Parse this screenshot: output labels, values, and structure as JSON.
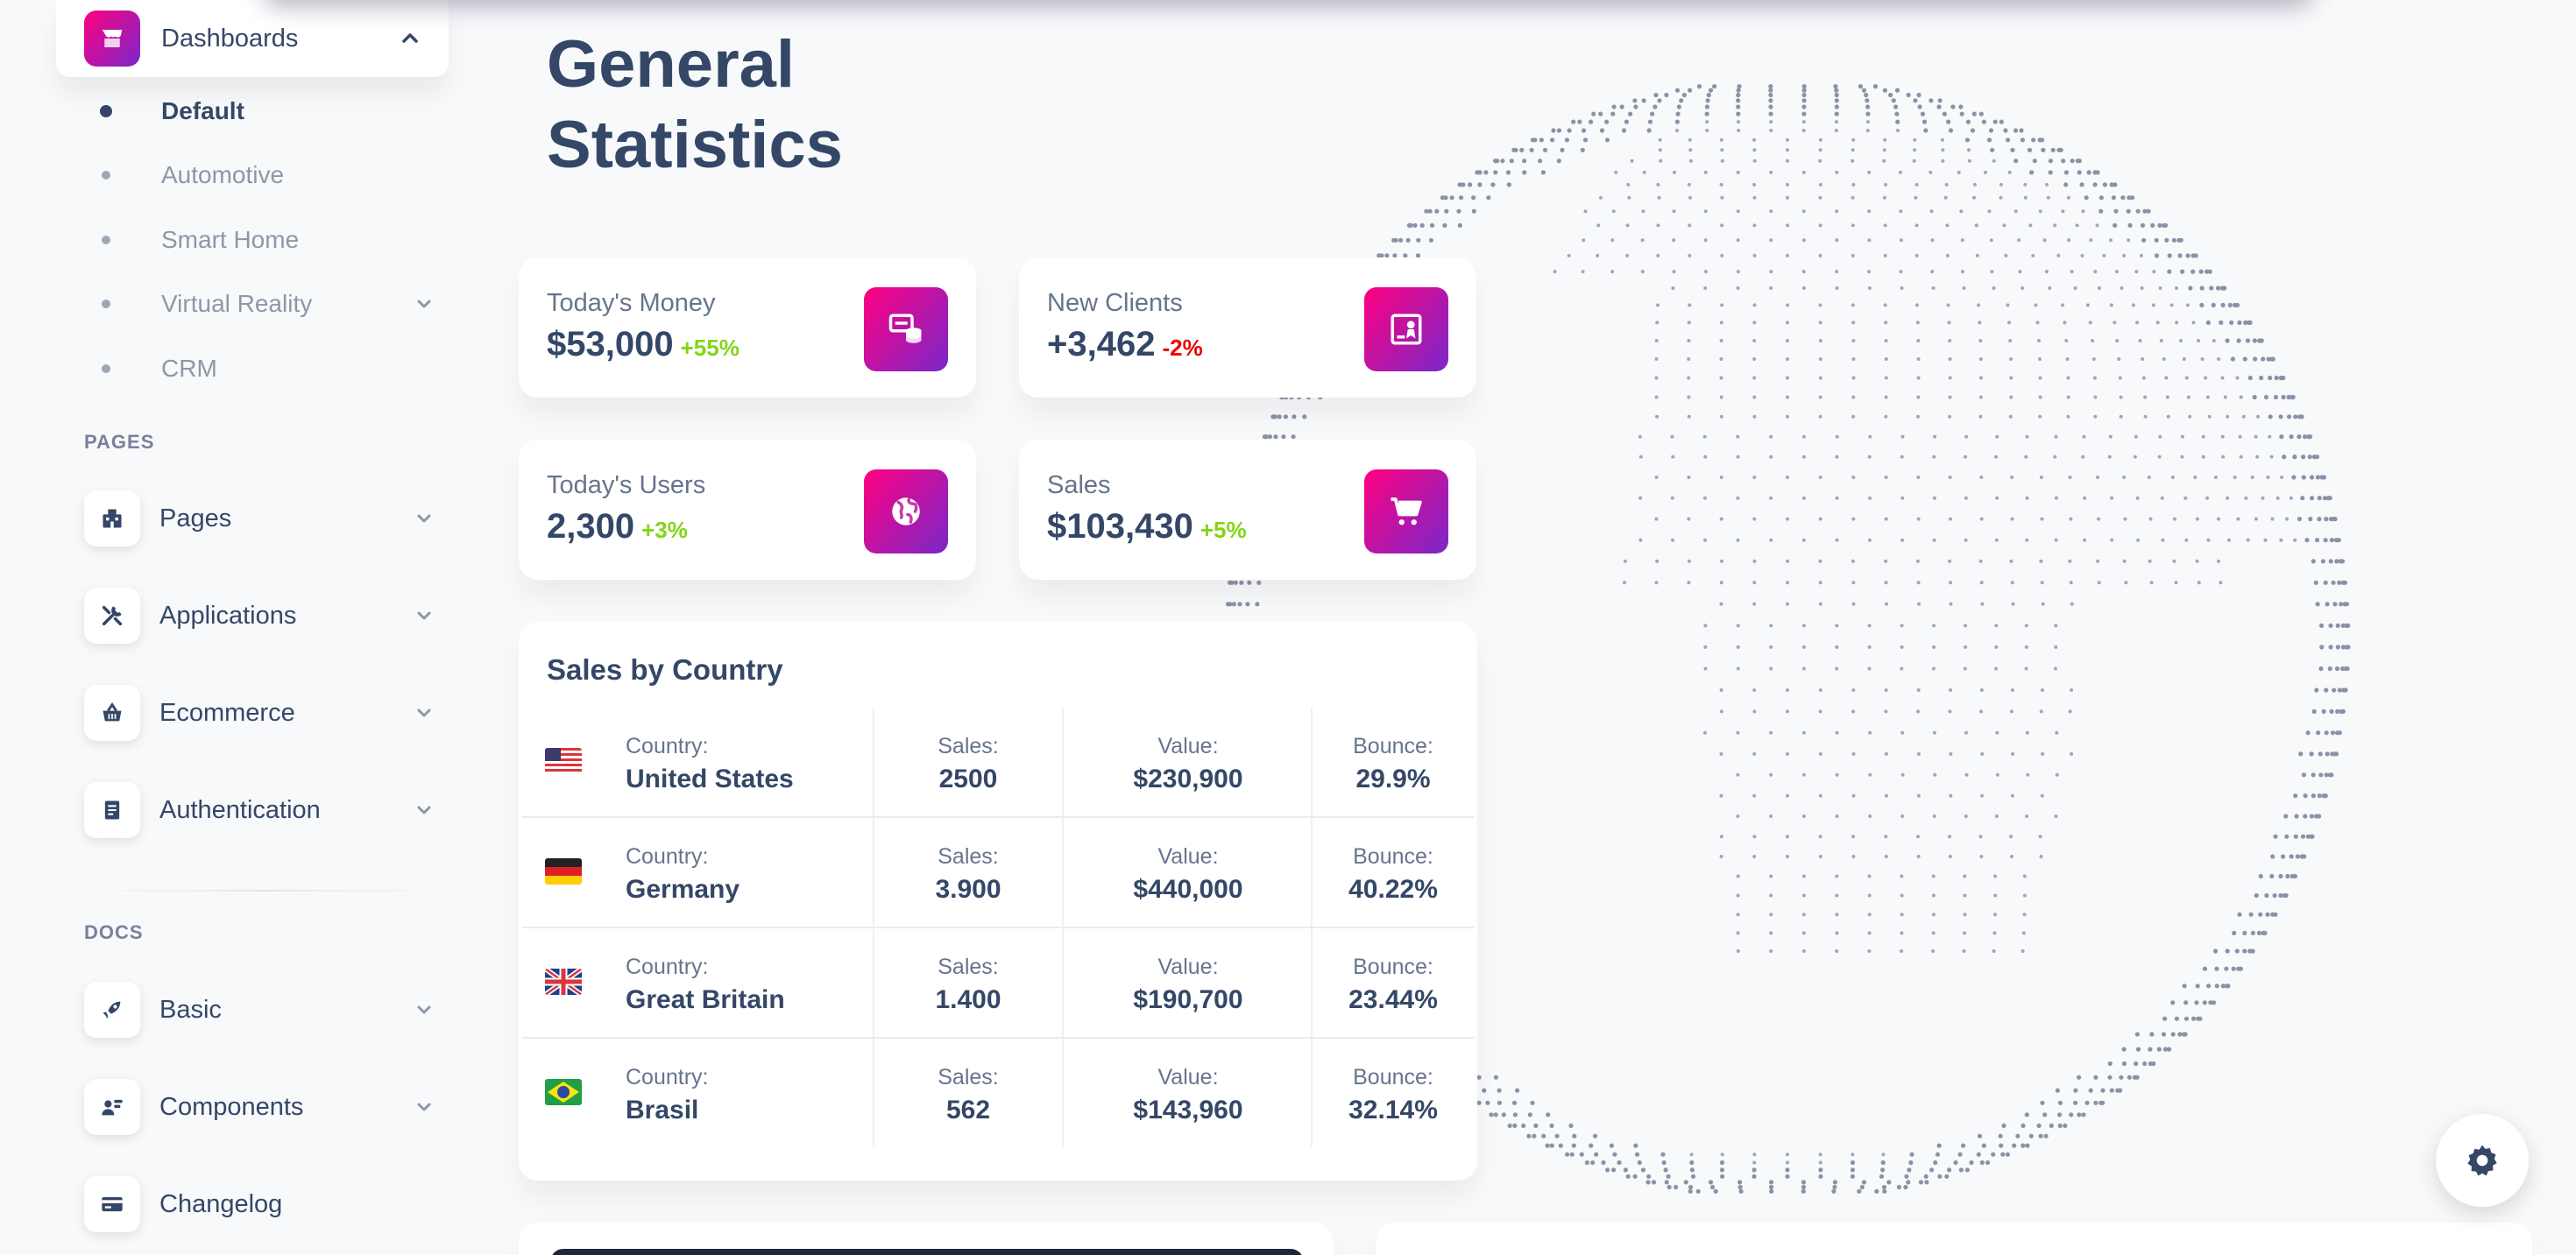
{
  "sidebar": {
    "dashboards": {
      "label": "Dashboards",
      "icon": "shop-icon",
      "expanded": true
    },
    "dashboard_items": [
      {
        "label": "Default",
        "active": true
      },
      {
        "label": "Automotive",
        "active": false
      },
      {
        "label": "Smart Home",
        "active": false
      },
      {
        "label": "Virtual Reality",
        "active": false,
        "has_submenu": true
      },
      {
        "label": "CRM",
        "active": false
      }
    ],
    "pages_section": "PAGES",
    "pages_items": [
      {
        "label": "Pages",
        "icon": "office-icon"
      },
      {
        "label": "Applications",
        "icon": "tools-icon"
      },
      {
        "label": "Ecommerce",
        "icon": "basket-icon"
      },
      {
        "label": "Authentication",
        "icon": "document-icon"
      }
    ],
    "docs_section": "DOCS",
    "docs_items": [
      {
        "label": "Basic",
        "icon": "rocket-icon"
      },
      {
        "label": "Components",
        "icon": "box-icon"
      },
      {
        "label": "Changelog",
        "icon": "credit-card-icon"
      }
    ]
  },
  "main": {
    "title": "General Statistics",
    "stats": [
      {
        "label": "Today's Money",
        "value": "$53,000",
        "change": "+55%",
        "trend": "positive",
        "icon": "money-coins-icon"
      },
      {
        "label": "New Clients",
        "value": "+3,462",
        "change": "-2%",
        "trend": "negative",
        "icon": "paper-diploma-icon"
      },
      {
        "label": "Today's Users",
        "value": "2,300",
        "change": "+3%",
        "trend": "positive",
        "icon": "world-icon"
      },
      {
        "label": "Sales",
        "value": "$103,430",
        "change": "+5%",
        "trend": "positive",
        "icon": "cart-icon"
      }
    ],
    "sales_by_country": {
      "title": "Sales by Country",
      "headers": {
        "country": "Country:",
        "sales": "Sales:",
        "value": "Value:",
        "bounce": "Bounce:"
      },
      "rows": [
        {
          "flag": "us-flag-icon",
          "country": "United States",
          "sales": "2500",
          "value": "$230,900",
          "bounce": "29.9%"
        },
        {
          "flag": "de-flag-icon",
          "country": "Germany",
          "sales": "3.900",
          "value": "$440,000",
          "bounce": "40.22%"
        },
        {
          "flag": "gb-flag-icon",
          "country": "Great Britain",
          "sales": "1.400",
          "value": "$190,700",
          "bounce": "23.44%"
        },
        {
          "flag": "br-flag-icon",
          "country": "Brasil",
          "sales": "562",
          "value": "$143,960",
          "bounce": "32.14%"
        }
      ]
    }
  },
  "colors": {
    "text_primary": "#344767",
    "text_secondary": "#67748e",
    "accent_gradient": [
      "#7928ca",
      "#ff0080"
    ],
    "positive": "#82d616",
    "negative": "#ea0606",
    "globe_dots": "#8b91a8"
  },
  "settings_icon": "gear-icon"
}
